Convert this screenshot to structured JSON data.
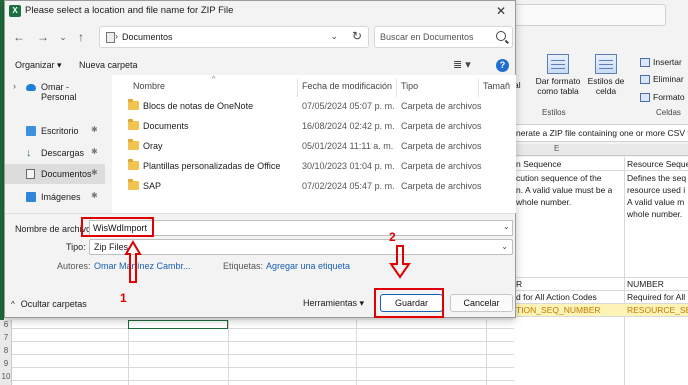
{
  "dialog": {
    "title": "Please select a location and file name for ZIP File",
    "app_icon": "X",
    "close": "✕"
  },
  "nav": {
    "back": "←",
    "forward": "→",
    "recent": "⌄",
    "up": "↑",
    "address_separator": "›",
    "address": "Documentos",
    "address_dropdown": "⌄",
    "refresh": "↻",
    "search_placeholder": "Buscar en Documentos"
  },
  "toolbar": {
    "organize": "Organizar ▾",
    "new_folder": "Nueva carpeta",
    "view": "≣ ▾",
    "help": "?"
  },
  "sidebar": {
    "items": [
      {
        "label": "Omar - Personal",
        "icon": "onedrive-icon",
        "chevron": "›"
      },
      {
        "label": "Escritorio",
        "icon": "desktop-icon"
      },
      {
        "label": "Descargas",
        "icon": "download-icon"
      },
      {
        "label": "Documentos",
        "icon": "documents-icon",
        "selected": true
      },
      {
        "label": "Imágenes",
        "icon": "images-icon"
      }
    ],
    "pin": "✱"
  },
  "files": {
    "sort_indicator": "^",
    "columns": [
      "Nombre",
      "Fecha de modificación",
      "Tipo",
      "Tamañ"
    ],
    "rows": [
      {
        "name": "Blocs de notas de OneNote",
        "date": "07/05/2024 05:07 p. m.",
        "type": "Carpeta de archivos"
      },
      {
        "name": "Documents",
        "date": "16/08/2024 02:42 p. m.",
        "type": "Carpeta de archivos"
      },
      {
        "name": "Oray",
        "date": "05/01/2024 11:11 a. m.",
        "type": "Carpeta de archivos"
      },
      {
        "name": "Plantillas personalizadas de Office",
        "date": "30/10/2023 01:04 p. m.",
        "type": "Carpeta de archivos"
      },
      {
        "name": "SAP",
        "date": "07/02/2024 05:47 p. m.",
        "type": "Carpeta de archivos"
      }
    ]
  },
  "form": {
    "filename_label": "Nombre de archivo:",
    "filename_value": "WisWdImport",
    "type_label": "Tipo:",
    "type_value": "Zip Files",
    "authors_label": "Autores:",
    "authors_value": "Omar Martínez Cambr...",
    "tags_label": "Etiquetas:",
    "tags_value": "Agregar una etiqueta",
    "dropdown": "⌄"
  },
  "footer": {
    "hide_folders": "Ocultar carpetas",
    "hide_chevron": "^",
    "tools": "Herramientas ▾",
    "save": "Guardar",
    "cancel": "Cancelar"
  },
  "annotations": {
    "step1": "1",
    "step2": "2",
    "color": "#e00000"
  },
  "excel": {
    "ribbon": {
      "partial_label": "al",
      "format_table": "Dar formato como tabla",
      "cell_styles": "Estilos de celda",
      "insert": "Insertar",
      "delete": "Eliminar",
      "format": "Formato",
      "styles_group": "Estilos",
      "cells_group": "Celdas"
    },
    "formula_text": "nerate a ZIP file containing one or more CSV f",
    "col_letter": "E",
    "cells": {
      "e_header": "n Sequence",
      "f_header": "Resource Seque",
      "e_desc": [
        "cution sequence of the",
        "n. A valid value must be a",
        "whole number."
      ],
      "f_desc": [
        "Defines the seq",
        "resource used i",
        "A valid value m",
        "whole number."
      ],
      "e_type": "R",
      "f_type": "NUMBER",
      "e_req": "d for All Action Codes",
      "f_req": "Required for All",
      "e_code": "TION_SEQ_NUMBER",
      "f_code": "RESOURCE_SEQ"
    },
    "rows": [
      "6",
      "7",
      "8",
      "9",
      "10"
    ]
  }
}
